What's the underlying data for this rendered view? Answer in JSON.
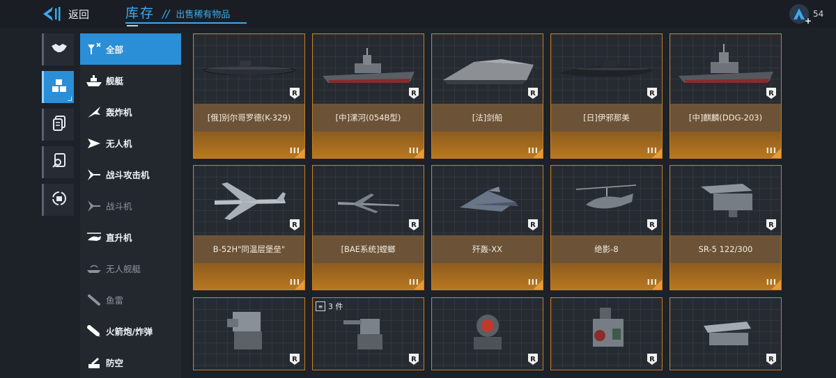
{
  "header": {
    "back_label": "返回",
    "title": "库存",
    "separator": "//",
    "subtitle": "出售稀有物品",
    "badge_count": "54"
  },
  "side_rail": [
    {
      "name": "handshake-icon",
      "active": false
    },
    {
      "name": "inventory-cubes-icon",
      "active": true
    },
    {
      "name": "documents-icon",
      "active": false
    },
    {
      "name": "search-document-icon",
      "active": false
    },
    {
      "name": "recycle-icon",
      "active": false
    }
  ],
  "categories": [
    {
      "label": "全部",
      "icon": "all-filter-icon",
      "active": true,
      "disabled": false
    },
    {
      "label": "舰艇",
      "icon": "ship-icon",
      "active": false,
      "disabled": false
    },
    {
      "label": "轰炸机",
      "icon": "bomber-icon",
      "active": false,
      "disabled": false
    },
    {
      "label": "无人机",
      "icon": "drone-icon",
      "active": false,
      "disabled": false
    },
    {
      "label": "战斗攻击机",
      "icon": "attack-jet-icon",
      "active": false,
      "disabled": false
    },
    {
      "label": "战斗机",
      "icon": "fighter-icon",
      "active": false,
      "disabled": true
    },
    {
      "label": "直升机",
      "icon": "helicopter-icon",
      "active": false,
      "disabled": false
    },
    {
      "label": "无人舰艇",
      "icon": "unmanned-ship-icon",
      "active": false,
      "disabled": true
    },
    {
      "label": "鱼雷",
      "icon": "torpedo-icon",
      "active": false,
      "disabled": true
    },
    {
      "label": "火箭炮/炸弹",
      "icon": "rocket-bomb-icon",
      "active": false,
      "disabled": false
    },
    {
      "label": "防空",
      "icon": "air-defense-icon",
      "active": false,
      "disabled": false
    }
  ],
  "items": [
    {
      "name": "[俄]别尔哥罗德(K-329)",
      "tier": "III",
      "kind": "submarine"
    },
    {
      "name": "[中]漯河(054B型)",
      "tier": "III",
      "kind": "frigate"
    },
    {
      "name": "[法]剑船",
      "tier": "III",
      "kind": "stealth"
    },
    {
      "name": "[日]伊邪那美",
      "tier": "III",
      "kind": "submarine2"
    },
    {
      "name": "[中]麒麟(DDG-203)",
      "tier": "III",
      "kind": "destroyer"
    },
    {
      "name": "B-52H\"同温层堡垒\"",
      "tier": "III",
      "kind": "bomber"
    },
    {
      "name": "[BAE系统]螳螂",
      "tier": "III",
      "kind": "drone"
    },
    {
      "name": "歼轰-XX",
      "tier": "III",
      "kind": "fighter"
    },
    {
      "name": "绝影-8",
      "tier": "III",
      "kind": "helicopter"
    },
    {
      "name": "SR-5 122/300",
      "tier": "III",
      "kind": "launcher"
    },
    {
      "name": "",
      "tier": "",
      "kind": "turret1",
      "count": ""
    },
    {
      "name": "",
      "tier": "",
      "kind": "turret2",
      "count": "3 件"
    },
    {
      "name": "",
      "tier": "",
      "kind": "turret3",
      "count": ""
    },
    {
      "name": "",
      "tier": "",
      "kind": "turret4",
      "count": ""
    },
    {
      "name": "",
      "tier": "",
      "kind": "turret5",
      "count": ""
    }
  ],
  "rarity_badge": "R",
  "colors": {
    "accent": "#3da9ef",
    "active_bg": "#2a8fd6",
    "card_border": "#c87f22",
    "name_band": "#6c5337"
  }
}
